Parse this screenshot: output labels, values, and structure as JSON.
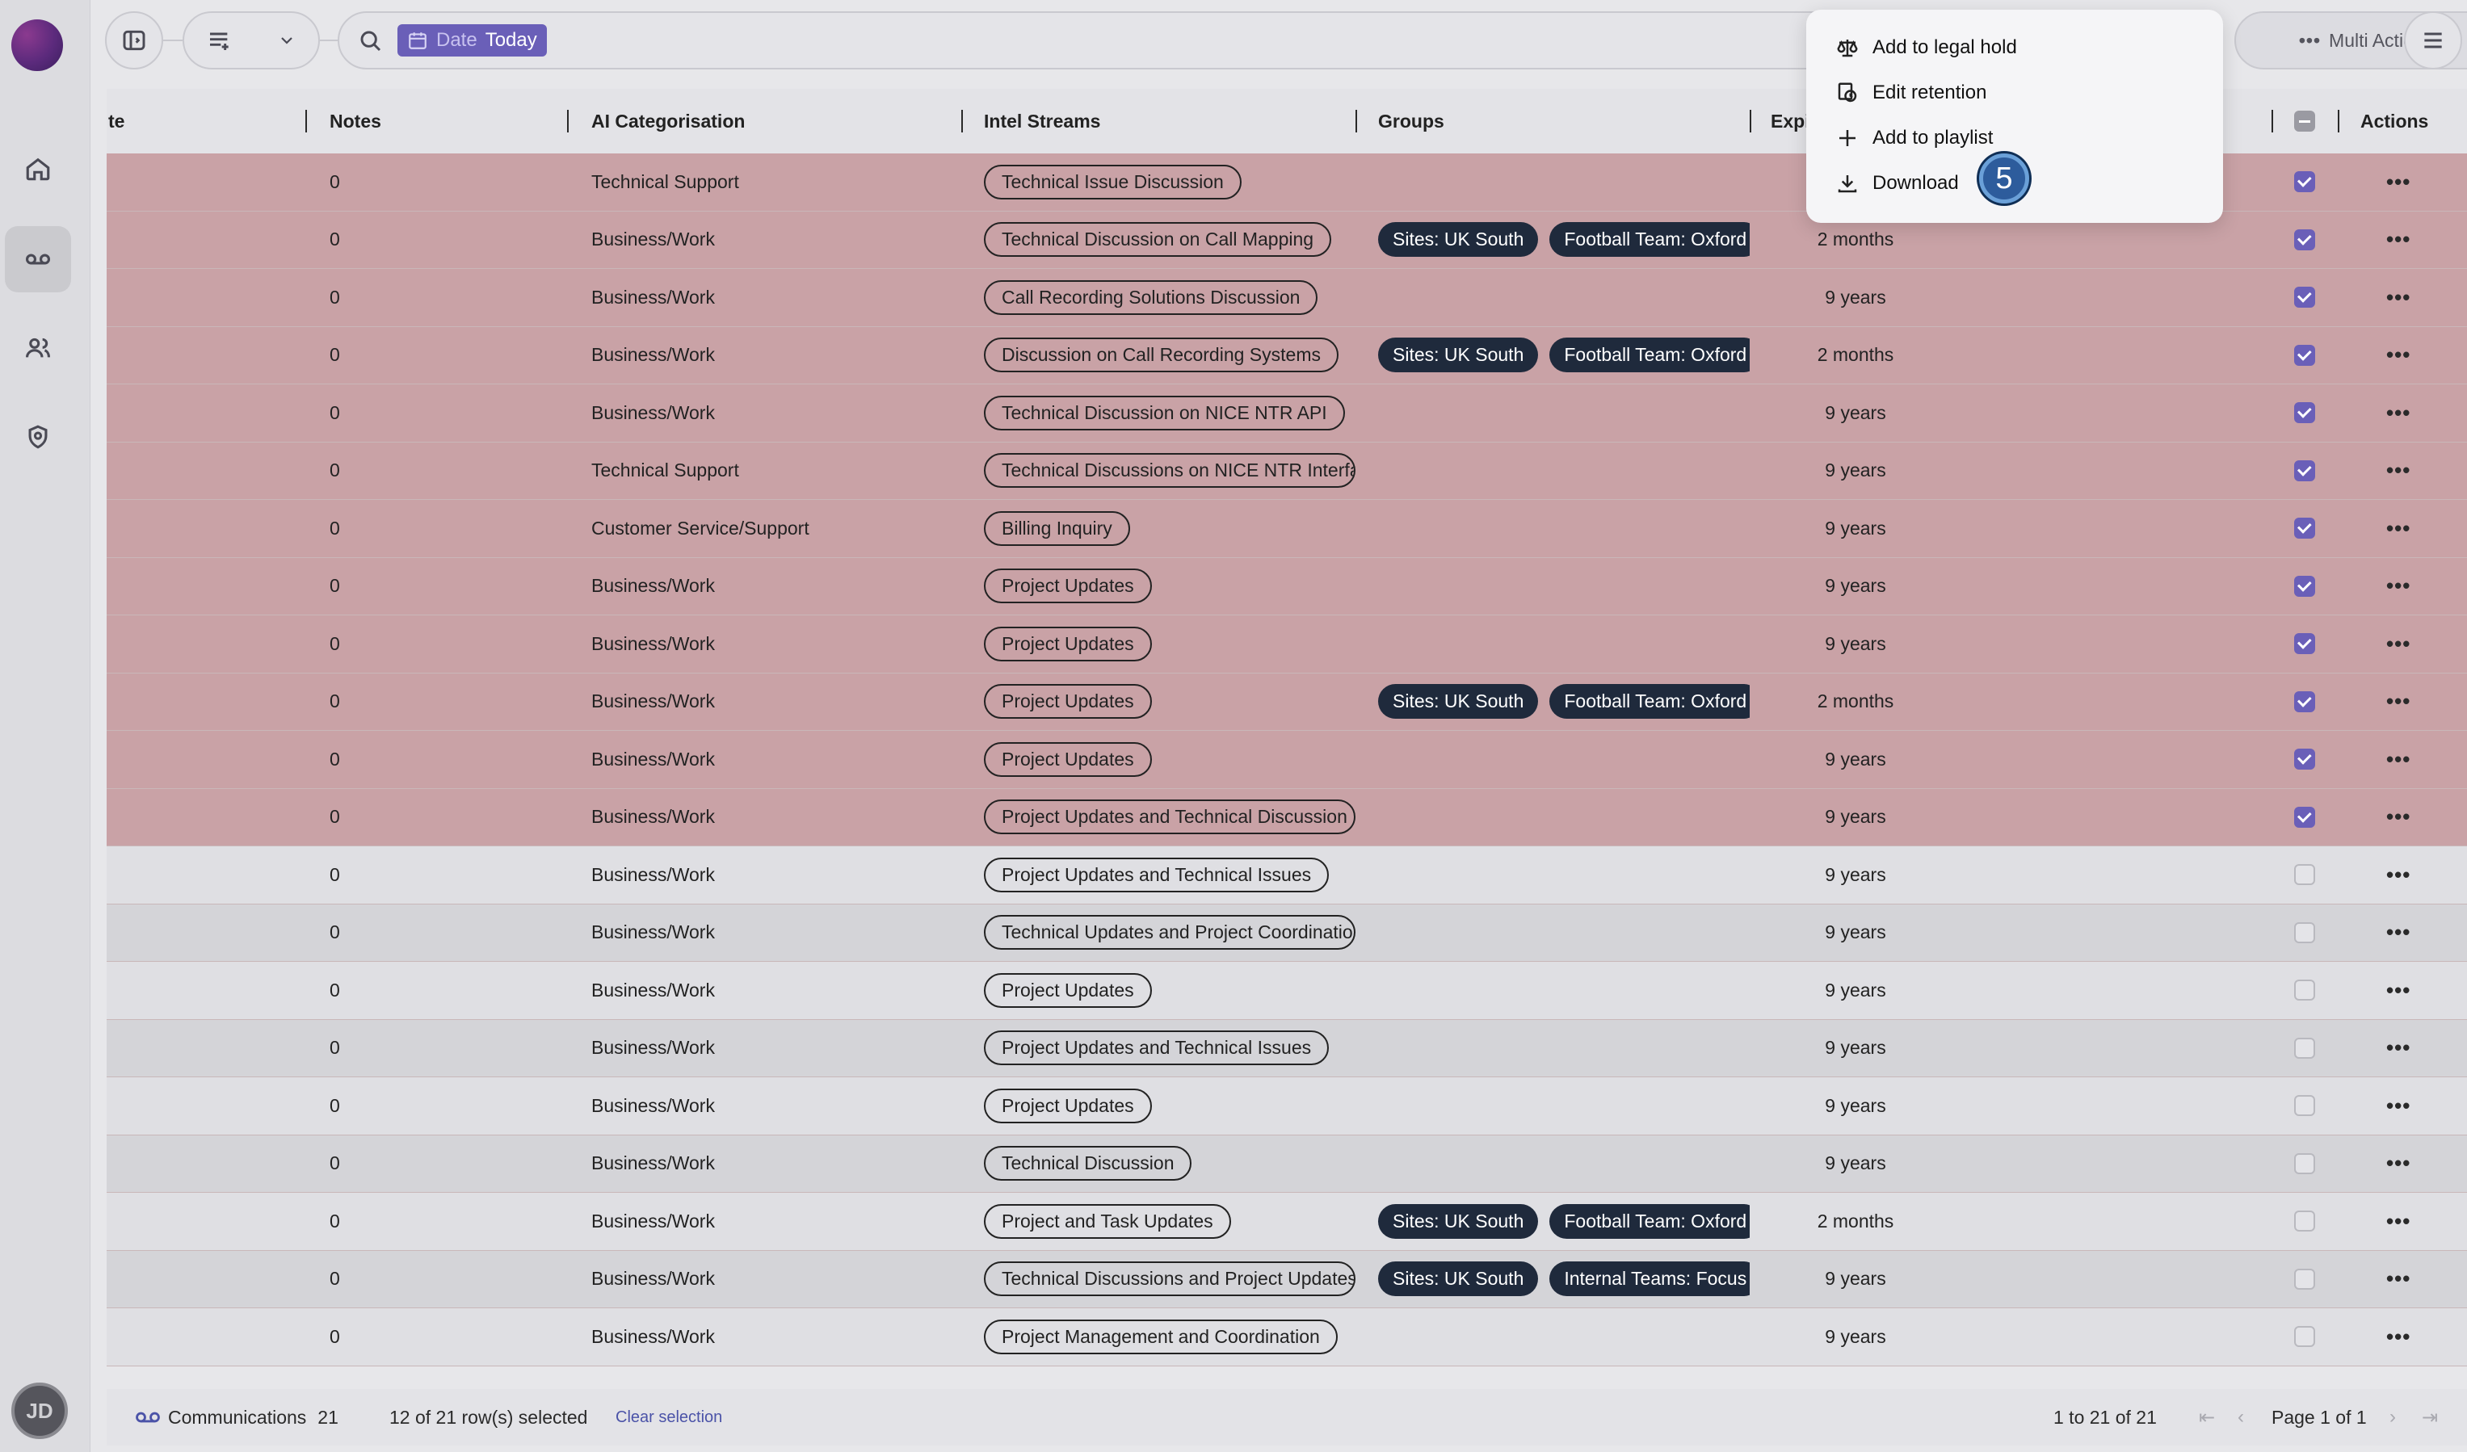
{
  "toolbar": {
    "date_label": "Date",
    "date_value": "Today",
    "multi_actions_label": "Multi Actions"
  },
  "menu": {
    "items": [
      {
        "label": "Add to legal hold",
        "icon": "scale-icon"
      },
      {
        "label": "Edit retention",
        "icon": "retention-icon"
      },
      {
        "label": "Add to playlist",
        "icon": "plus-icon"
      },
      {
        "label": "Download",
        "icon": "download-icon"
      }
    ],
    "step_badge": "5"
  },
  "table": {
    "headers": {
      "date": "te",
      "notes": "Notes",
      "ai": "AI Categorisation",
      "streams": "Intel Streams",
      "groups": "Groups",
      "expiry": "Expi",
      "actions": "Actions"
    },
    "rows": [
      {
        "notes": "0",
        "ai": "Technical Support",
        "stream": "Technical Issue Discussion",
        "g1": "",
        "g2": "",
        "expiry": "",
        "sel": true
      },
      {
        "notes": "0",
        "ai": "Business/Work",
        "stream": "Technical Discussion on Call Mapping",
        "g1": "Sites: UK South",
        "g2": "Football Team: Oxford",
        "expiry": "2 months",
        "sel": true
      },
      {
        "notes": "0",
        "ai": "Business/Work",
        "stream": "Call Recording Solutions Discussion",
        "g1": "",
        "g2": "",
        "expiry": "9 years",
        "sel": true
      },
      {
        "notes": "0",
        "ai": "Business/Work",
        "stream": "Discussion on Call Recording Systems",
        "g1": "Sites: UK South",
        "g2": "Football Team: Oxford",
        "expiry": "2 months",
        "sel": true
      },
      {
        "notes": "0",
        "ai": "Business/Work",
        "stream": "Technical Discussion on NICE NTR API",
        "g1": "",
        "g2": "",
        "expiry": "9 years",
        "sel": true
      },
      {
        "notes": "0",
        "ai": "Technical Support",
        "stream": "Technical Discussions on NICE NTR Interface",
        "g1": "",
        "g2": "",
        "expiry": "9 years",
        "sel": true
      },
      {
        "notes": "0",
        "ai": "Customer Service/Support",
        "stream": "Billing Inquiry",
        "g1": "",
        "g2": "",
        "expiry": "9 years",
        "sel": true
      },
      {
        "notes": "0",
        "ai": "Business/Work",
        "stream": "Project Updates",
        "g1": "",
        "g2": "",
        "expiry": "9 years",
        "sel": true
      },
      {
        "notes": "0",
        "ai": "Business/Work",
        "stream": "Project Updates",
        "g1": "",
        "g2": "",
        "expiry": "9 years",
        "sel": true
      },
      {
        "notes": "0",
        "ai": "Business/Work",
        "stream": "Project Updates",
        "g1": "Sites: UK South",
        "g2": "Football Team: Oxford",
        "expiry": "2 months",
        "sel": true
      },
      {
        "notes": "0",
        "ai": "Business/Work",
        "stream": "Project Updates",
        "g1": "",
        "g2": "",
        "expiry": "9 years",
        "sel": true
      },
      {
        "notes": "0",
        "ai": "Business/Work",
        "stream": "Project Updates and Technical Discussion",
        "g1": "",
        "g2": "",
        "expiry": "9 years",
        "sel": true
      },
      {
        "notes": "0",
        "ai": "Business/Work",
        "stream": "Project Updates and Technical Issues",
        "g1": "",
        "g2": "",
        "expiry": "9 years",
        "sel": false
      },
      {
        "notes": "0",
        "ai": "Business/Work",
        "stream": "Technical Updates and Project Coordination",
        "g1": "",
        "g2": "",
        "expiry": "9 years",
        "sel": false
      },
      {
        "notes": "0",
        "ai": "Business/Work",
        "stream": "Project Updates",
        "g1": "",
        "g2": "",
        "expiry": "9 years",
        "sel": false
      },
      {
        "notes": "0",
        "ai": "Business/Work",
        "stream": "Project Updates and Technical Issues",
        "g1": "",
        "g2": "",
        "expiry": "9 years",
        "sel": false
      },
      {
        "notes": "0",
        "ai": "Business/Work",
        "stream": "Project Updates",
        "g1": "",
        "g2": "",
        "expiry": "9 years",
        "sel": false
      },
      {
        "notes": "0",
        "ai": "Business/Work",
        "stream": "Technical Discussion",
        "g1": "",
        "g2": "",
        "expiry": "9 years",
        "sel": false
      },
      {
        "notes": "0",
        "ai": "Business/Work",
        "stream": "Project and Task Updates",
        "g1": "Sites: UK South",
        "g2": "Football Team: Oxford",
        "expiry": "2 months",
        "sel": false
      },
      {
        "notes": "0",
        "ai": "Business/Work",
        "stream": "Technical Discussions and Project Updates",
        "g1": "Sites: UK South",
        "g2": "Internal Teams: Focus",
        "expiry": "9 years",
        "sel": false
      },
      {
        "notes": "0",
        "ai": "Business/Work",
        "stream": "Project Management and Coordination",
        "g1": "",
        "g2": "",
        "expiry": "9 years",
        "sel": false
      }
    ]
  },
  "footer": {
    "communications_label": "Communications",
    "communications_count": "21",
    "selected_text": "12 of 21 row(s) selected",
    "clear_selection": "Clear selection",
    "range_text": "1 to 21 of 21",
    "page_text": "Page 1 of 1"
  },
  "user": {
    "initials": "JD"
  },
  "colors": {
    "accent": "#6a5fb8",
    "selected_row": "#c9a2a6",
    "group_tag": "#1f2a3c"
  }
}
